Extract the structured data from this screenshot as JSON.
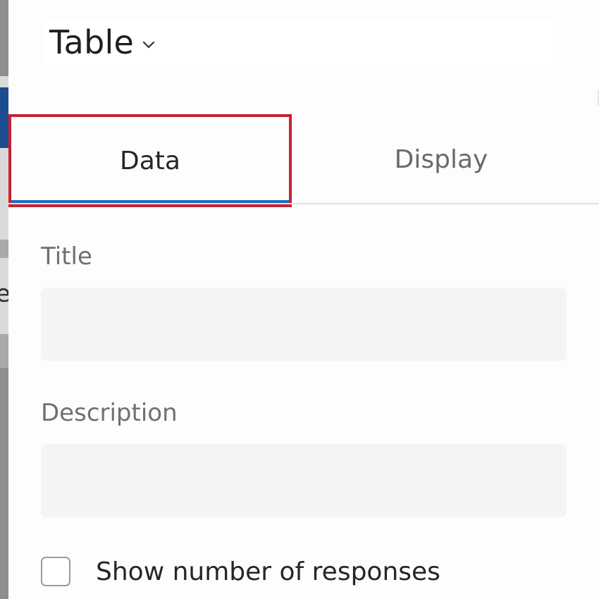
{
  "header": {
    "title": "Table",
    "dropdown_icon": "chevron-down-icon"
  },
  "tabs": [
    {
      "label": "Data",
      "active": true
    },
    {
      "label": "Display",
      "active": false
    }
  ],
  "form": {
    "title_label": "Title",
    "title_value": "",
    "description_label": "Description",
    "description_value": "",
    "show_responses_label": "Show number of responses",
    "show_responses_checked": false
  },
  "colors": {
    "active_tab_underline": "#1e6bc4",
    "highlight_outline": "#c62232",
    "input_background": "#f4f4f4",
    "label_text": "#707070"
  }
}
